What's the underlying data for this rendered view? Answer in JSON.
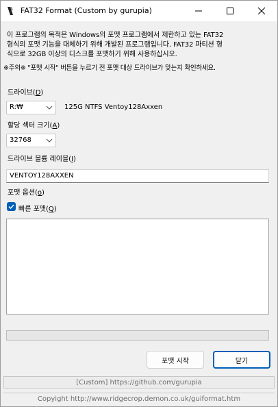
{
  "window": {
    "title": "FAT32 Format (Custom by gurupia)"
  },
  "description": {
    "line1": "이 프로그램의 목적은 Windows의 포맷 프로그램에서 제한하고 있는 FAT32",
    "line2": "형식의 포맷 기능을 대체하기 위해 개발된 프로그램입니다. FAT32 파티션 형",
    "line3": "식으로 32GB 이상의 디스크를 포맷하기 위해 사용하십시오.",
    "warning": "※주의※ \"포맷 시작\" 버튼을 누르기 전 포맷 대상 드라이브가 맞는지 확인하세요."
  },
  "drive": {
    "label": "드라이브(",
    "accel": "D",
    "label_end": ")",
    "value": "R:₩",
    "info": "125G NTFS Ventoy128Axxen"
  },
  "cluster": {
    "label": "할당 섹터 크기(",
    "accel": "A",
    "label_end": ")",
    "value": "32768"
  },
  "volume": {
    "label": "드라이브 볼륨 레이블(",
    "accel": "I",
    "label_end": ")",
    "value": "VENTOY128AXXEN"
  },
  "options": {
    "label": "포맷 옵션(",
    "accel": "o",
    "label_end": ")",
    "quick_label": "빠른 포맷(",
    "quick_accel": "Q",
    "quick_end": ")",
    "quick_checked": true
  },
  "progress": {
    "value": 0
  },
  "buttons": {
    "format": "포맷 시작",
    "close": "닫기"
  },
  "links": {
    "custom": "[Custom] https://github.com/gurupia",
    "copyright": "Copyight  http://www.ridgecrop.demon.co.uk/guiformat.htm"
  },
  "colors": {
    "accent": "#005fb8",
    "link_text": "#6d6d6d"
  },
  "icons": {
    "app": "fat32-app-icon",
    "minimize": "minimize-icon",
    "maximize": "maximize-icon",
    "close": "close-icon",
    "check": "check-icon",
    "chevron": "chevron-down-icon"
  }
}
